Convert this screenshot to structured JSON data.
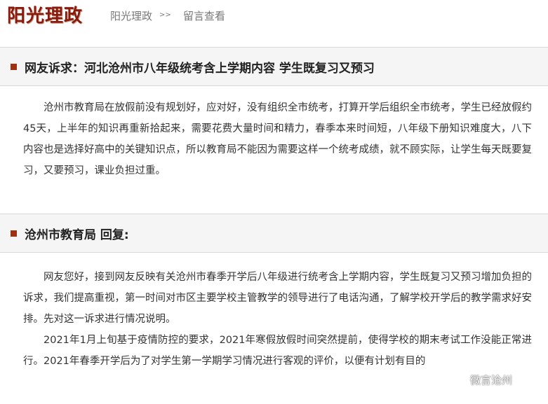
{
  "header": {
    "logo_text": "阳光理政",
    "nav": [
      {
        "label": "阳光理政"
      },
      {
        "label": "留言查看"
      }
    ],
    "nav_separator": ">>"
  },
  "complaint": {
    "title": "网友诉求：河北沧州市八年级统考含上学期内容 学生既复习又预习",
    "paragraphs": [
      "沧州市教育局在放假前没有规划好，应对好，没有组织全市统考，打算开学后组织全市统考，学生已经放假约45天，上半年的知识再重新拾起来，需要花费大量时间和精力，春季本来时间短，八年级下册知识难度大，八下内容也是选择好高中的关键知识点，所以教育局不能因为需要这样一个统考成绩，就不顾实际，让学生每天既要复习，又要预习，课业负担过重。"
    ]
  },
  "reply": {
    "title": "沧州市教育局 回复:",
    "paragraphs": [
      "网友您好，接到网友反映有关沧州市春季开学后八年级进行统考含上学期内容，学生既复习又预习增加负担的诉求，我们提高重视，第一时间对市区主要学校主管教学的领导进行了电话沟通，了解学校开学后的教学需求好安排。先对这一诉求进行情况说明。",
      "2021年1月上旬基于疫情防控的要求，2021年寒假放假时间突然提前，使得学校的期末考试工作没能正常进行。2021年春季开学后为了对学生第一学期学习情况进行客观的评价，以便有计划有目的"
    ]
  },
  "watermark": {
    "text": "微言沧州",
    "icon": "chat-bubble-icon"
  }
}
